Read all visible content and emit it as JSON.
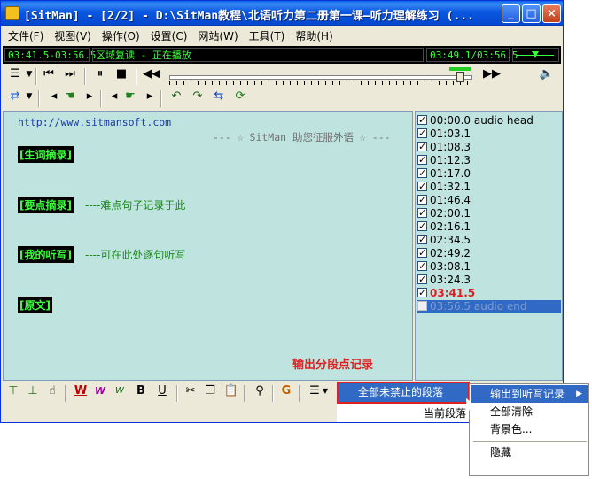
{
  "window": {
    "title": "[SitMan] - [2/2] - D:\\SitMan教程\\北语听力第二册第一课—听力理解练习 (...",
    "controls": {
      "minimize": "_",
      "maximize": "□",
      "close": "×"
    }
  },
  "menubar": {
    "items": [
      "文件(F)",
      "视图(V)",
      "操作(O)",
      "设置(C)",
      "网站(W)",
      "工具(T)",
      "帮助(H)"
    ]
  },
  "status": {
    "range": "03:41.5-03:56.5",
    "mode": "区域复读 - 正在播放",
    "position": "03:49.1/03:56.5"
  },
  "text_pane": {
    "url": "http://www.sitmansoft.com",
    "slogan": "--- ☆ SitMan 助您征服外语 ☆ ---",
    "sections": [
      {
        "label": "[生词摘录]",
        "note": ""
      },
      {
        "label": "[要点摘录]",
        "note": "----难点句子记录于此"
      },
      {
        "label": "[我的听写]",
        "note": "----可在此处逐句听写"
      },
      {
        "label": "[原文]",
        "note": ""
      }
    ],
    "footer_note": "输出分段点记录"
  },
  "segments": [
    {
      "time": "00:00.0",
      "label": "audio head",
      "checked": true,
      "style": "normal"
    },
    {
      "time": "01:03.1",
      "label": "",
      "checked": true,
      "style": "normal"
    },
    {
      "time": "01:08.3",
      "label": "",
      "checked": true,
      "style": "normal"
    },
    {
      "time": "01:12.3",
      "label": "",
      "checked": true,
      "style": "normal"
    },
    {
      "time": "01:17.0",
      "label": "",
      "checked": true,
      "style": "normal"
    },
    {
      "time": "01:32.1",
      "label": "",
      "checked": true,
      "style": "normal"
    },
    {
      "time": "01:46.4",
      "label": "",
      "checked": true,
      "style": "normal"
    },
    {
      "time": "02:00.1",
      "label": "",
      "checked": true,
      "style": "normal"
    },
    {
      "time": "02:16.1",
      "label": "",
      "checked": true,
      "style": "normal"
    },
    {
      "time": "02:34.5",
      "label": "",
      "checked": true,
      "style": "normal"
    },
    {
      "time": "02:49.2",
      "label": "",
      "checked": true,
      "style": "normal"
    },
    {
      "time": "03:08.1",
      "label": "",
      "checked": true,
      "style": "normal"
    },
    {
      "time": "03:24.3",
      "label": "",
      "checked": true,
      "style": "normal"
    },
    {
      "time": "03:41.5",
      "label": "",
      "checked": true,
      "style": "current"
    },
    {
      "time": "03:56.5",
      "label": "audio end",
      "checked": false,
      "style": "selected"
    }
  ],
  "bottom_toolbar": {
    "buttons": [
      "W",
      "W",
      "W",
      "B",
      "U"
    ]
  },
  "context_menu": {
    "active_item": "全部未禁止的段落",
    "partial_item": "当前段落",
    "submenu_trigger": "输出到听写记录",
    "items": [
      "全部清除",
      "背景色...",
      "隐藏"
    ]
  },
  "colors": {
    "text_bg": "#bfe4e0",
    "lcd_green": "#3cff3c",
    "highlight": "#316ac5",
    "current_segment": "#e02020",
    "annotation_red": "#e02020"
  }
}
